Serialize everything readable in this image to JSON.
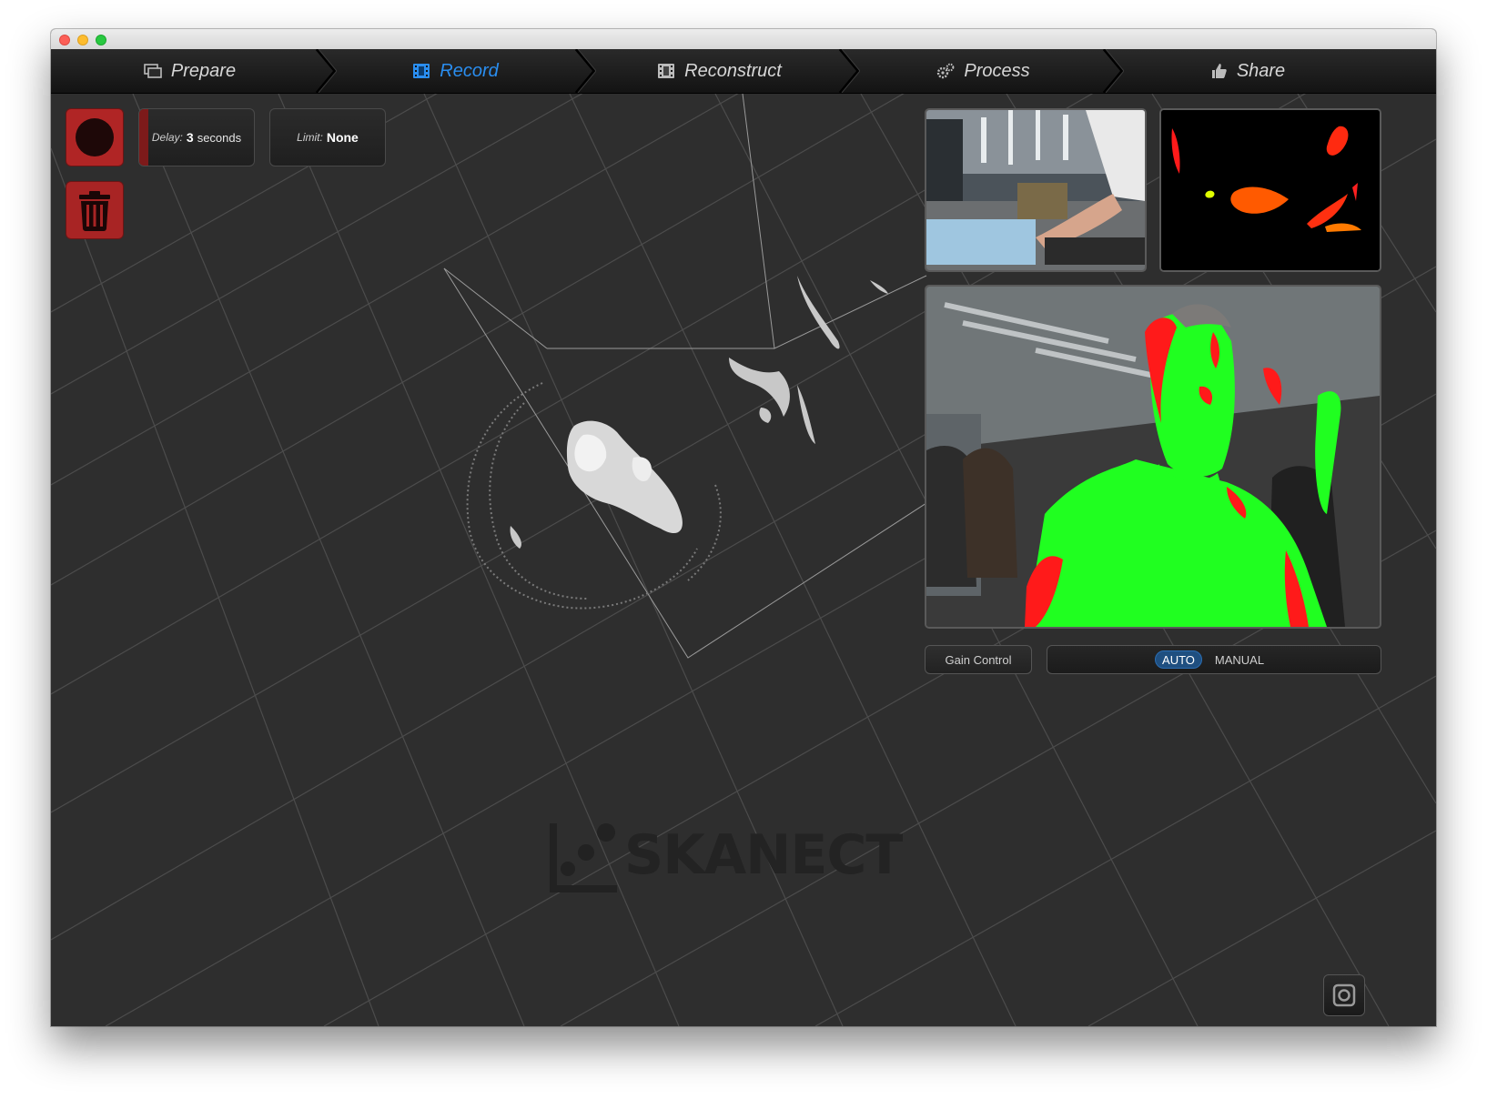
{
  "tabs": [
    {
      "label": "Prepare",
      "icon": "monitor-icon",
      "active": false
    },
    {
      "label": "Record",
      "icon": "film-icon",
      "active": true
    },
    {
      "label": "Reconstruct",
      "icon": "film-strip-icon",
      "active": false
    },
    {
      "label": "Process",
      "icon": "gears-icon",
      "active": false
    },
    {
      "label": "Share",
      "icon": "thumbs-up-icon",
      "active": false
    }
  ],
  "controls": {
    "delay": {
      "label": "Delay:",
      "value": "3",
      "unit": "seconds"
    },
    "limit": {
      "label": "Limit:",
      "value": "None"
    }
  },
  "gain": {
    "label": "Gain Control",
    "options": [
      "AUTO",
      "MANUAL"
    ],
    "selected": "AUTO"
  },
  "logo_text": "SKANECT",
  "colors": {
    "accent": "#2a8ef0",
    "record": "#b02525",
    "background": "#2e2e2e",
    "depth_match": "#20ff20",
    "depth_miss": "#ff1a1a"
  }
}
